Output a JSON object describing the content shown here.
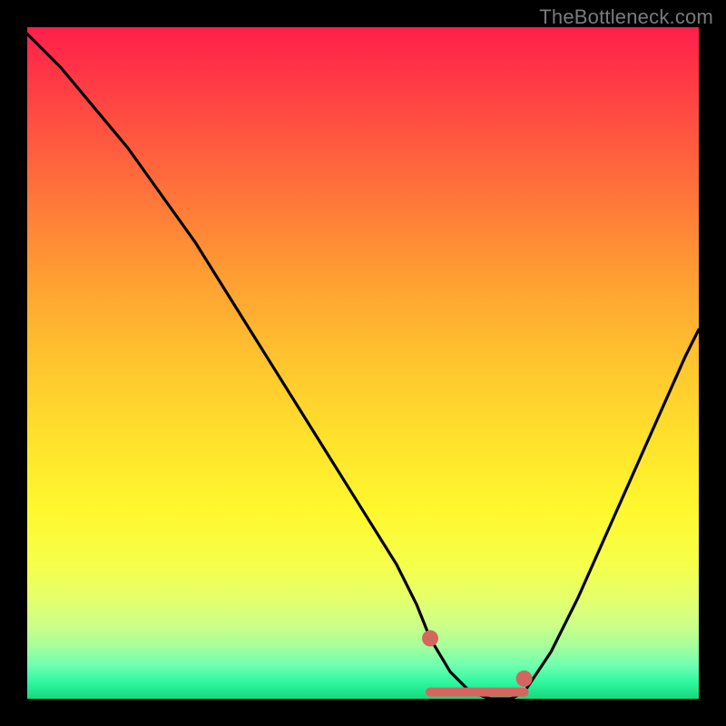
{
  "watermark": "TheBottleneck.com",
  "chart_data": {
    "type": "line",
    "title": "",
    "xlabel": "",
    "ylabel": "",
    "xlim": [
      0,
      100
    ],
    "ylim": [
      0,
      100
    ],
    "grid": false,
    "legend": false,
    "series": [
      {
        "name": "bottleneck-curve",
        "color": "#000000",
        "x": [
          0,
          5,
          10,
          15,
          20,
          25,
          30,
          35,
          40,
          45,
          50,
          55,
          58,
          60,
          63,
          66,
          69,
          72,
          74,
          78,
          82,
          86,
          90,
          94,
          98,
          100
        ],
        "y": [
          99,
          94,
          88,
          82,
          75,
          68,
          60,
          52,
          44,
          36,
          28,
          20,
          14,
          9,
          4,
          1,
          0,
          0,
          1,
          7,
          15,
          24,
          33,
          42,
          51,
          55
        ]
      }
    ],
    "markers": [
      {
        "name": "sweet-spot-start",
        "x": 60,
        "y": 9,
        "color": "#d4665f",
        "size": 9
      },
      {
        "name": "sweet-spot-end",
        "x": 74,
        "y": 3,
        "color": "#d4665f",
        "size": 9
      }
    ],
    "flat_region": {
      "x_start": 60,
      "x_end": 74,
      "y": 1,
      "color": "#d4665f",
      "thickness": 10
    },
    "background_gradient": {
      "stops": [
        {
          "pos": 0.0,
          "color": "#ff1f4b"
        },
        {
          "pos": 0.5,
          "color": "#ffc52e"
        },
        {
          "pos": 0.8,
          "color": "#f6ff4a"
        },
        {
          "pos": 1.0,
          "color": "#17d97a"
        }
      ]
    }
  }
}
